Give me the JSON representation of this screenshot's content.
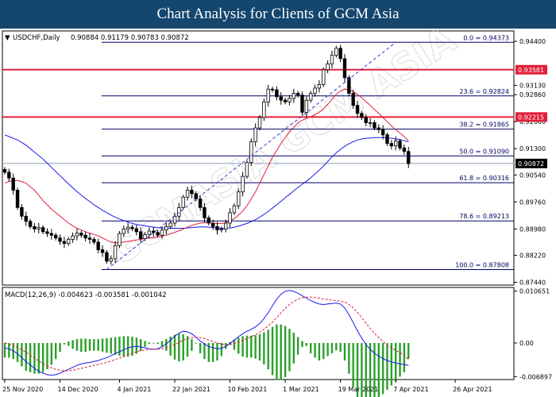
{
  "header": {
    "title": "Chart Analysis for Clients of GCM Asia"
  },
  "chart_data": {
    "type": "candlestick",
    "main": {
      "symbol_label": "USDCHF,Daily",
      "ohlc_label": "0.90884 0.91179 0.90783 0.90872",
      "ylim": [
        0.8736,
        0.947
      ],
      "y_tick_labels": [
        "0.94400",
        "0.93130",
        "0.92860",
        "0.92080",
        "0.91300",
        "0.90540",
        "0.89760",
        "0.88980",
        "0.88220",
        "0.87440"
      ],
      "y_tick_values": [
        0.944,
        0.9313,
        0.9286,
        0.9208,
        0.913,
        0.9054,
        0.8976,
        0.8898,
        0.8822,
        0.8744
      ],
      "current_price": {
        "value": 0.90872,
        "label": "0.90872",
        "color": "#000000"
      },
      "resistance_lines": [
        {
          "value": 0.93581,
          "label": "0.93581",
          "color": "#e0203a"
        },
        {
          "value": 0.92215,
          "label": "0.92215",
          "color": "#e0203a"
        }
      ],
      "fibonacci": [
        {
          "level": "0.0",
          "value": 0.94373,
          "label": "0.0 = 0.94373"
        },
        {
          "level": "23.6",
          "value": 0.92824,
          "label": "23.6 = 0.92824"
        },
        {
          "level": "38.2",
          "value": 0.91865,
          "label": "38.2 = 0.91865"
        },
        {
          "level": "50.0",
          "value": 0.9109,
          "label": "50.0 = 0.91090"
        },
        {
          "level": "61.8",
          "value": 0.90316,
          "label": "61.8 = 0.90316"
        },
        {
          "level": "78.6",
          "value": 0.89213,
          "label": "78.6 = 0.89213"
        },
        {
          "level": "100.0",
          "value": 0.87808,
          "label": "100.0 = 0.87808"
        }
      ],
      "candle_closes": [
        0.9062,
        0.9045,
        0.901,
        0.896,
        0.8935,
        0.892,
        0.8905,
        0.8898,
        0.8902,
        0.889,
        0.8885,
        0.888,
        0.8872,
        0.8862,
        0.8856,
        0.8868,
        0.8878,
        0.8886,
        0.888,
        0.8872,
        0.8868,
        0.886,
        0.8838,
        0.883,
        0.8805,
        0.8812,
        0.885,
        0.8885,
        0.8898,
        0.8903,
        0.8899,
        0.889,
        0.887,
        0.8882,
        0.8892,
        0.8888,
        0.888,
        0.8895,
        0.8905,
        0.8915,
        0.8935,
        0.896,
        0.899,
        0.901,
        0.9,
        0.8985,
        0.896,
        0.893,
        0.8915,
        0.8905,
        0.8895,
        0.8898,
        0.8915,
        0.8945,
        0.8965,
        0.9005,
        0.905,
        0.909,
        0.915,
        0.919,
        0.922,
        0.9265,
        0.9302,
        0.93,
        0.928,
        0.927,
        0.9265,
        0.9275,
        0.929,
        0.9285,
        0.9235,
        0.927,
        0.929,
        0.9305,
        0.9315,
        0.9358,
        0.9375,
        0.94,
        0.942,
        0.939,
        0.9335,
        0.929,
        0.9255,
        0.9232,
        0.922,
        0.9205,
        0.9205,
        0.919,
        0.9185,
        0.917,
        0.9145,
        0.9138,
        0.9152,
        0.9132,
        0.9122,
        0.9087
      ],
      "ma_red": [
        0.903,
        0.9035,
        0.9038,
        0.9038,
        0.9035,
        0.903,
        0.902,
        0.901,
        0.8995,
        0.898,
        0.8968,
        0.8955,
        0.8945,
        0.8935,
        0.8925,
        0.8915,
        0.8907,
        0.89,
        0.8895,
        0.889,
        0.8886,
        0.8882,
        0.8878,
        0.8872,
        0.8866,
        0.886,
        0.8858,
        0.8858,
        0.886,
        0.8862,
        0.8864,
        0.8866,
        0.8868,
        0.887,
        0.8872,
        0.8873,
        0.8875,
        0.8877,
        0.888,
        0.8884,
        0.8888,
        0.8893,
        0.8898,
        0.8903,
        0.8908,
        0.8912,
        0.8915,
        0.8916,
        0.8916,
        0.8915,
        0.8914,
        0.8914,
        0.8916,
        0.8921,
        0.8928,
        0.8938,
        0.895,
        0.8965,
        0.8985,
        0.9005,
        0.903,
        0.9055,
        0.908,
        0.9105,
        0.9125,
        0.9145,
        0.9162,
        0.9178,
        0.9192,
        0.9204,
        0.9212,
        0.9218,
        0.9222,
        0.9228,
        0.9235,
        0.9245,
        0.9258,
        0.9272,
        0.9287,
        0.9297,
        0.9302,
        0.93,
        0.9295,
        0.9287,
        0.9277,
        0.9266,
        0.9255,
        0.9243,
        0.9232,
        0.922,
        0.9208,
        0.9196,
        0.9185,
        0.9175,
        0.9165,
        0.9153
      ],
      "ma_blue": [
        0.917,
        0.9165,
        0.916,
        0.9155,
        0.9148,
        0.914,
        0.913,
        0.912,
        0.911,
        0.91,
        0.9088,
        0.9076,
        0.9064,
        0.9052,
        0.904,
        0.9028,
        0.9017,
        0.9006,
        0.8996,
        0.8986,
        0.8977,
        0.8968,
        0.896,
        0.8952,
        0.8945,
        0.8938,
        0.8932,
        0.8927,
        0.8922,
        0.8918,
        0.8914,
        0.8911,
        0.8909,
        0.8907,
        0.8905,
        0.8903,
        0.8902,
        0.8901,
        0.89,
        0.89,
        0.89,
        0.89,
        0.89,
        0.8901,
        0.8902,
        0.8903,
        0.8904,
        0.8904,
        0.8903,
        0.8902,
        0.8901,
        0.89,
        0.89,
        0.8901,
        0.8903,
        0.8906,
        0.891,
        0.8914,
        0.8919,
        0.8925,
        0.8932,
        0.894,
        0.8949,
        0.8958,
        0.8968,
        0.8978,
        0.8988,
        0.8998,
        0.9008,
        0.9018,
        0.9027,
        0.9036,
        0.9046,
        0.9057,
        0.9068,
        0.908,
        0.9093,
        0.9106,
        0.9118,
        0.9128,
        0.9137,
        0.9144,
        0.915,
        0.9155,
        0.9158,
        0.916,
        0.9161,
        0.9162,
        0.9162,
        0.9162,
        0.9161,
        0.916,
        0.9158,
        0.9156,
        0.9153,
        0.915
      ]
    },
    "macd": {
      "label": "MACD(12,26,9) -0.004623 -0.003581 -0.001042",
      "ylim": [
        -0.0075,
        0.0114
      ],
      "y_tick_labels": [
        "0.010651",
        "0.00",
        "-0.006897"
      ],
      "y_tick_values": [
        0.010651,
        0.0,
        -0.006897
      ],
      "macd_line": [
        -0.001,
        -0.0012,
        -0.0016,
        -0.0022,
        -0.003,
        -0.0038,
        -0.0045,
        -0.0052,
        -0.0058,
        -0.0062,
        -0.0065,
        -0.0066,
        -0.0065,
        -0.0062,
        -0.0058,
        -0.0054,
        -0.005,
        -0.0046,
        -0.0043,
        -0.0041,
        -0.004,
        -0.0038,
        -0.0036,
        -0.0033,
        -0.003,
        -0.0026,
        -0.0022,
        -0.0018,
        -0.0014,
        -0.001,
        -0.0008,
        -0.0007,
        -0.0008,
        -0.001,
        -0.0012,
        -0.0013,
        -0.0012,
        -0.0008,
        -0.0002,
        0.0006,
        0.0014,
        0.002,
        0.0024,
        0.0023,
        0.0019,
        0.0012,
        0.0004,
        -0.0002,
        -0.0007,
        -0.001,
        -0.0012,
        -0.0011,
        -0.0007,
        -0.0001,
        0.0006,
        0.0013,
        0.0019,
        0.0024,
        0.0028,
        0.0033,
        0.004,
        0.005,
        0.0062,
        0.0076,
        0.009,
        0.01,
        0.0106,
        0.0108,
        0.0106,
        0.0102,
        0.0097,
        0.0092,
        0.0087,
        0.0083,
        0.008,
        0.0079,
        0.008,
        0.0081,
        0.0082,
        0.008,
        0.0072,
        0.0058,
        0.0042,
        0.0025,
        0.001,
        -0.0003,
        -0.0013,
        -0.0021,
        -0.0027,
        -0.0032,
        -0.0036,
        -0.0039,
        -0.0041,
        -0.0043,
        -0.0044,
        -0.0046
      ],
      "signal_line": [
        0.0,
        -0.0002,
        -0.0005,
        -0.0009,
        -0.0014,
        -0.0019,
        -0.0025,
        -0.0031,
        -0.0037,
        -0.0042,
        -0.0047,
        -0.0051,
        -0.0054,
        -0.0056,
        -0.0057,
        -0.0057,
        -0.0056,
        -0.0054,
        -0.0052,
        -0.005,
        -0.0048,
        -0.0046,
        -0.0044,
        -0.0042,
        -0.004,
        -0.0037,
        -0.0034,
        -0.0031,
        -0.0028,
        -0.0024,
        -0.0021,
        -0.0018,
        -0.0016,
        -0.0014,
        -0.0013,
        -0.0013,
        -0.0013,
        -0.0012,
        -0.001,
        -0.0007,
        -0.0003,
        0.0001,
        0.0006,
        0.0009,
        0.0011,
        0.0012,
        0.0011,
        0.0009,
        0.0006,
        0.0003,
        0.0,
        -0.0002,
        -0.0003,
        -0.0003,
        -0.0001,
        0.0002,
        0.0005,
        0.0009,
        0.0013,
        0.0017,
        0.0022,
        0.0028,
        0.0035,
        0.0043,
        0.0052,
        0.0062,
        0.0071,
        0.0079,
        0.0085,
        0.009,
        0.0093,
        0.0094,
        0.0094,
        0.0093,
        0.0092,
        0.009,
        0.0089,
        0.0088,
        0.0087,
        0.0086,
        0.0084,
        0.0079,
        0.0072,
        0.0063,
        0.0052,
        0.0041,
        0.003,
        0.002,
        0.0011,
        0.0003,
        -0.0004,
        -0.001,
        -0.0015,
        -0.002,
        -0.0024,
        -0.0035
      ]
    },
    "x_tick_labels": [
      "25 Nov 2020",
      "14 Dec 2020",
      "4 Jan 2021",
      "22 Jan 2021",
      "10 Feb 2021",
      "1 Mar 2021",
      "19 Mar 2021",
      "7 Apr 2021",
      "26 Apr 2021"
    ],
    "x_tick_indices": [
      0,
      13,
      27,
      40,
      53,
      66,
      79,
      92,
      106
    ],
    "colors": {
      "candle": "#000000",
      "up_body": "#ffffff",
      "down_body": "#000000",
      "ma_red": "#e0203a",
      "ma_blue": "#1a1aee",
      "fib": "#000066",
      "trendline": "#3a3ad0",
      "macd_hist": "#2aa02a",
      "macd_line": "#1a1aee",
      "macd_signal": "#e0203a",
      "watermark": "#c8c8c8"
    },
    "watermark": "GCMASIA GCM ASIA"
  }
}
